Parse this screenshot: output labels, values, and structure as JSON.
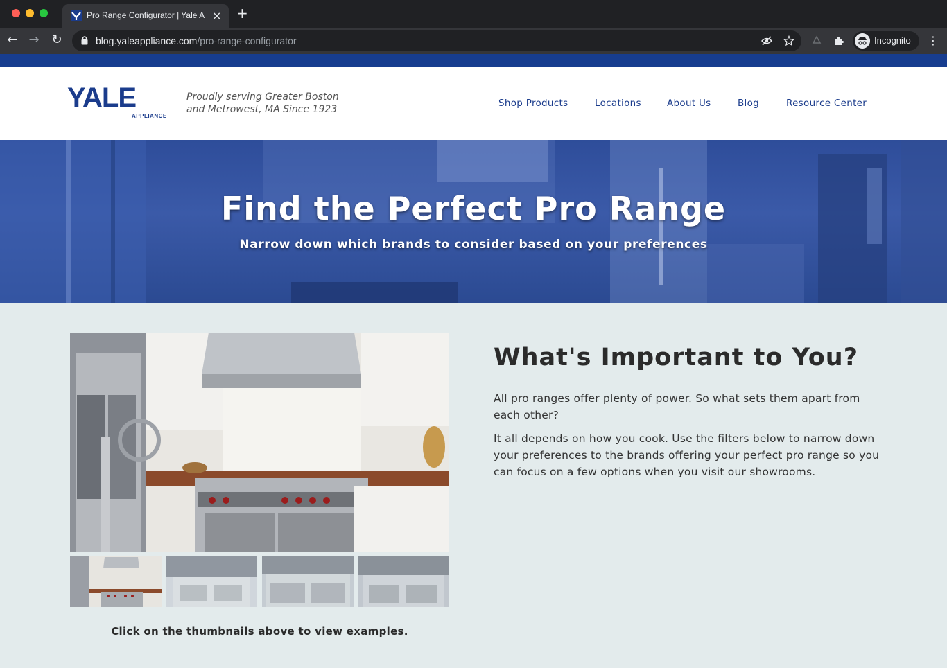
{
  "browser": {
    "tab_title": "Pro Range Configurator | Yale A",
    "url_domain": "blog.yaleappliance.com",
    "url_path": "/pro-range-configurator",
    "profile_label": "Incognito"
  },
  "site": {
    "logo_text": "YALE",
    "logo_sub": "APPLIANCE",
    "tagline_line1": "Proudly serving Greater Boston",
    "tagline_line2": "and Metrowest, MA Since 1923",
    "nav": [
      "Shop Products",
      "Locations",
      "About Us",
      "Blog",
      "Resource Center"
    ],
    "colors": {
      "brand_blue": "#1b3c8c",
      "strip_blue": "#173d8f",
      "page_bg": "#e3ebec"
    }
  },
  "hero": {
    "title": "Find the Perfect Pro Range",
    "subtitle": "Narrow down which brands to consider based on your preferences"
  },
  "gallery": {
    "caption": "Click on the thumbnails above to view examples."
  },
  "content": {
    "heading": "What's Important to You?",
    "paragraph1": "All pro ranges offer plenty of power. So what sets them apart from each other?",
    "paragraph2": "It all depends on how you cook. Use the filters below to narrow down your preferences to the brands offering your perfect pro range so you can focus on a few options when you visit our showrooms."
  }
}
